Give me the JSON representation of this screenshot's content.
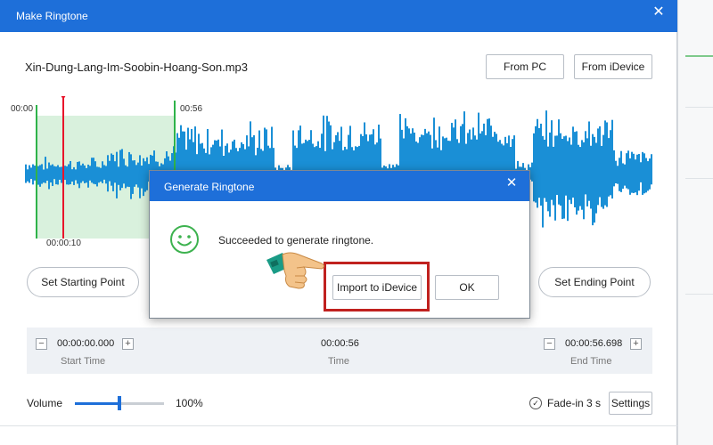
{
  "window": {
    "title": "Make Ringtone",
    "close_glyph": "✕"
  },
  "file": {
    "name": "Xin-Dung-Lang-Im-Soobin-Hoang-Son.mp3"
  },
  "buttons": {
    "from_pc": "From PC",
    "from_idevice": "From iDevice",
    "set_starting_point": "Set Starting Point",
    "set_ending_point": "Set Ending Point",
    "settings": "Settings"
  },
  "waveform": {
    "start_label": "00:00",
    "marker_label": "00:56",
    "playhead_label": "00:00:10",
    "colors": {
      "wave": "#1a8fd6",
      "selection": "#d9f1dd",
      "playhead": "#e8142b",
      "selection_edge": "#2fb34a"
    }
  },
  "time_panel": {
    "start_time": {
      "value": "00:00:00.000",
      "label": "Start Time"
    },
    "duration": {
      "value": "00:00:56",
      "label": "Time"
    },
    "end_time": {
      "value": "00:00:56.698",
      "label": "End Time"
    },
    "minus_glyph": "−",
    "plus_glyph": "+"
  },
  "volume": {
    "label": "Volume",
    "percent_text": "100%",
    "level": 0.5
  },
  "fade": {
    "label": "Fade-in 3 s",
    "checked": true
  },
  "dialog": {
    "title": "Generate Ringtone",
    "message": "Succeeded to generate ringtone.",
    "import_button": "Import to iDevice",
    "ok_button": "OK",
    "icon": "smiley-icon",
    "accent_color": "#1e6fd9",
    "highlight_color": "#c0211f"
  }
}
